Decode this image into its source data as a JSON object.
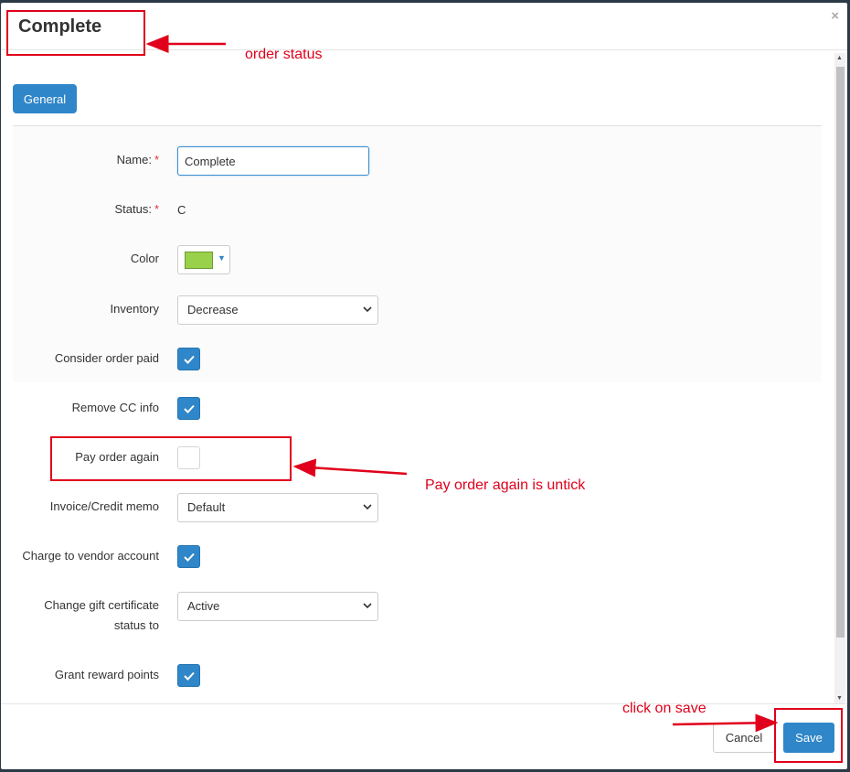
{
  "dialog": {
    "title": "Complete",
    "close_icon": "×",
    "tab_general": "General"
  },
  "form": {
    "name": {
      "label": "Name:",
      "value": "Complete",
      "required": "*"
    },
    "status": {
      "label": "Status:",
      "value": "C",
      "required": "*"
    },
    "color": {
      "label": "Color",
      "value_hex": "#9ad14b",
      "caret": "▼"
    },
    "inventory": {
      "label": "Inventory",
      "value": "Decrease"
    },
    "consider_paid": {
      "label": "Consider order paid",
      "checked": true
    },
    "remove_cc": {
      "label": "Remove CC info",
      "checked": true
    },
    "pay_again": {
      "label": "Pay order again",
      "checked": false
    },
    "invoice": {
      "label": "Invoice/Credit memo",
      "value": "Default"
    },
    "charge_vendor": {
      "label": "Charge to vendor account",
      "checked": true
    },
    "gift_cert": {
      "label_line1": "Change gift certificate",
      "label_line2": "status to",
      "value": "Active"
    },
    "reward_points": {
      "label": "Grant reward points",
      "checked": true
    }
  },
  "footer": {
    "cancel_label": "Cancel",
    "save_label": "Save"
  },
  "annotations": {
    "order_status": "order status",
    "pay_again_note": "Pay order again is untick",
    "click_save": "click on save",
    "color": "#e0001b"
  },
  "icons": {
    "check": "check-icon",
    "close": "close-icon",
    "select_chevron": "chevron-down-icon"
  }
}
